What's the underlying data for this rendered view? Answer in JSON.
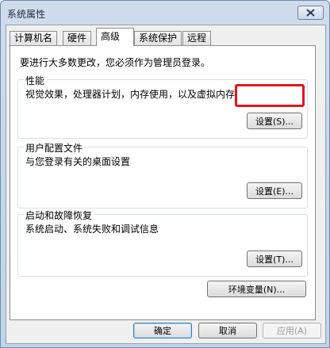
{
  "window": {
    "title": "系统属性"
  },
  "tabs": [
    {
      "label": "计算机名"
    },
    {
      "label": "硬件"
    },
    {
      "label": "高级"
    },
    {
      "label": "系统保护"
    },
    {
      "label": "远程"
    }
  ],
  "intro": "要进行大多数更改，您必须作为管理员登录。",
  "performance": {
    "title": "性能",
    "desc": "视觉效果，处理器计划，内存使用，以及虚拟内存",
    "button": "设置(S)..."
  },
  "profiles": {
    "title": "用户配置文件",
    "desc": "与您登录有关的桌面设置",
    "button": "设置(E)..."
  },
  "startup": {
    "title": "启动和故障恢复",
    "desc": "系统启动、系统失败和调试信息",
    "button": "设置(T)..."
  },
  "env_button": "环境变量(N)...",
  "footer": {
    "ok": "确定",
    "cancel": "取消",
    "apply": "应用(A)"
  },
  "colors": {
    "highlight": "#e4161c",
    "title_bar": "#c2d3e8"
  }
}
